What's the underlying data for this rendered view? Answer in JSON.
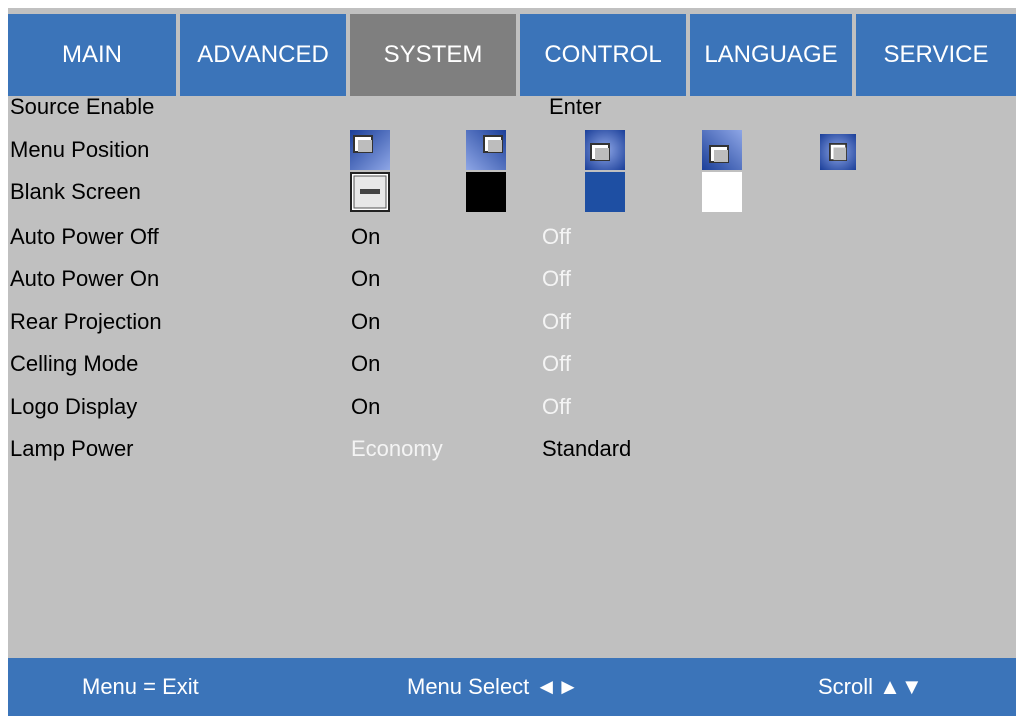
{
  "tabs": [
    "MAIN",
    "ADVANCED",
    "SYSTEM",
    "CONTROL",
    "LANGUAGE",
    "SERVICE"
  ],
  "active_tab": "SYSTEM",
  "colors": {
    "tab_bg": "#3b74b9",
    "tab_active_bg": "#7f7f7f",
    "panel_bg": "#c0c0c0",
    "selected_text": "#000000",
    "unselected_text": "#f4f4f4",
    "blank_blue": "#1e4fa3"
  },
  "rows": {
    "source_enable": {
      "label": "Source Enable",
      "value": "Enter"
    },
    "menu_position": {
      "label": "Menu Position",
      "icons": [
        "top-left-icon",
        "top-right-icon",
        "center-icon",
        "bottom-left-icon",
        "bottom-right-icon"
      ]
    },
    "blank_screen": {
      "label": "Blank Screen",
      "swatches": [
        "logo-swatch",
        "black-swatch",
        "blue-swatch",
        "white-swatch"
      ]
    },
    "auto_power_off": {
      "label": "Auto Power Off",
      "on": "On",
      "off": "Off"
    },
    "auto_power_on": {
      "label": "Auto Power On",
      "on": "On",
      "off": "Off"
    },
    "rear_projection": {
      "label": "Rear Projection",
      "on": "On",
      "off": "Off"
    },
    "ceiling_mode": {
      "label": "Celling Mode",
      "on": "On",
      "off": "Off"
    },
    "logo_display": {
      "label": "Logo Display",
      "on": "On",
      "off": "Off"
    },
    "lamp_power": {
      "label": "Lamp Power",
      "economy": "Economy",
      "standard": "Standard"
    }
  },
  "footer": {
    "exit": "Menu = Exit",
    "select": "Menu Select  ◄►",
    "scroll": "Scroll  ▲▼"
  }
}
